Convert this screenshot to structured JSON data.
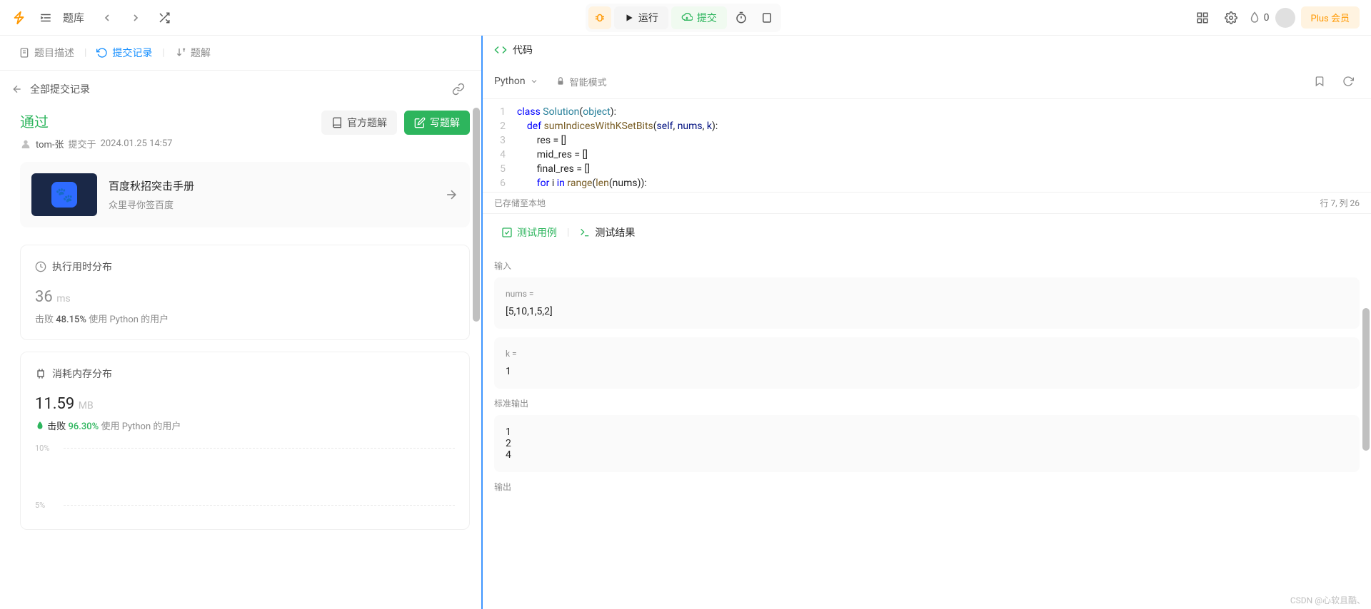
{
  "topbar": {
    "problems_label": "题库",
    "run_label": "运行",
    "submit_label": "提交",
    "streak_count": "0",
    "plus_label": "Plus 会员"
  },
  "left": {
    "tabs": {
      "description": "题目描述",
      "submissions": "提交记录",
      "solutions": "题解"
    },
    "breadcrumb": "全部提交记录",
    "status": "通过",
    "author": "tom-张",
    "submitted_prefix": "提交于",
    "submitted_at": "2024.01.25 14:57",
    "official_solution": "官方题解",
    "write_solution": "写题解",
    "promo": {
      "title": "百度秋招突击手册",
      "subtitle": "众里寻你签百度"
    },
    "runtime": {
      "header": "执行用时分布",
      "value": "36",
      "unit": "ms",
      "beats_prefix": "击败",
      "beats_pct": "48.15%",
      "beats_suffix": "使用 Python 的用户"
    },
    "memory": {
      "header": "消耗内存分布",
      "value": "11.59",
      "unit": "MB",
      "beats_prefix": "击败",
      "beats_pct": "96.30%",
      "beats_suffix": "使用 Python 的用户"
    },
    "chart_labels": {
      "p10": "10%",
      "p5": "5%"
    }
  },
  "right": {
    "code_label": "代码",
    "language": "Python",
    "mode_label": "智能模式",
    "code_lines": [
      "class Solution(object):",
      "    def sumIndicesWithKSetBits(self, nums, k):",
      "        res = []",
      "        mid_res = []",
      "        final_res = []",
      "        for i in range(len(nums)):"
    ],
    "saved_label": "已存储至本地",
    "cursor_label": "行 7, 列 26",
    "test_case_tab": "测试用例",
    "test_result_tab": "测试结果",
    "input_label": "输入",
    "nums_key": "nums =",
    "nums_val": "[5,10,1,5,2]",
    "k_key": "k =",
    "k_val": "1",
    "stdout_label": "标准输出",
    "stdout_val": "1\n2\n4",
    "output_label": "输出"
  },
  "watermark": "CSDN @心软且酷、"
}
